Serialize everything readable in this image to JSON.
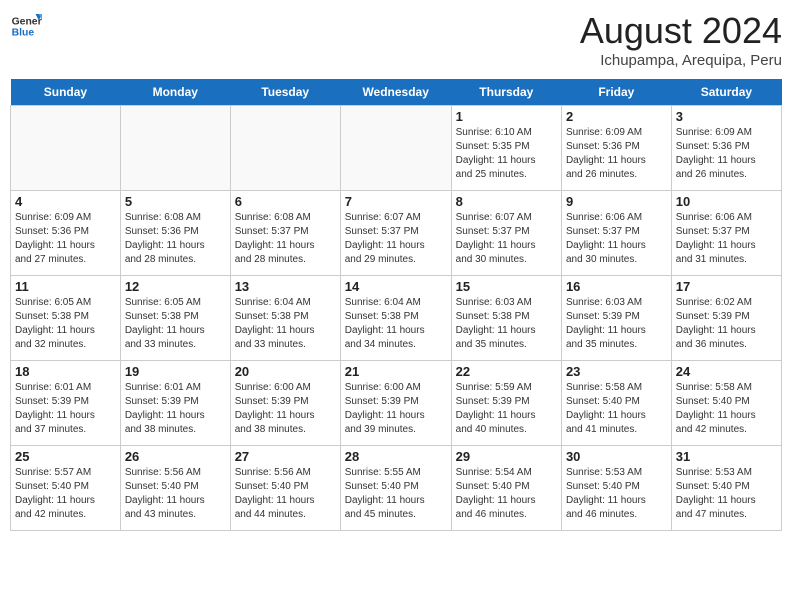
{
  "header": {
    "logo_line1": "General",
    "logo_line2": "Blue",
    "main_title": "August 2024",
    "subtitle": "Ichupampa, Arequipa, Peru"
  },
  "days_of_week": [
    "Sunday",
    "Monday",
    "Tuesday",
    "Wednesday",
    "Thursday",
    "Friday",
    "Saturday"
  ],
  "weeks": [
    [
      {
        "day": "",
        "info": ""
      },
      {
        "day": "",
        "info": ""
      },
      {
        "day": "",
        "info": ""
      },
      {
        "day": "",
        "info": ""
      },
      {
        "day": "1",
        "info": "Sunrise: 6:10 AM\nSunset: 5:35 PM\nDaylight: 11 hours\nand 25 minutes."
      },
      {
        "day": "2",
        "info": "Sunrise: 6:09 AM\nSunset: 5:36 PM\nDaylight: 11 hours\nand 26 minutes."
      },
      {
        "day": "3",
        "info": "Sunrise: 6:09 AM\nSunset: 5:36 PM\nDaylight: 11 hours\nand 26 minutes."
      }
    ],
    [
      {
        "day": "4",
        "info": "Sunrise: 6:09 AM\nSunset: 5:36 PM\nDaylight: 11 hours\nand 27 minutes."
      },
      {
        "day": "5",
        "info": "Sunrise: 6:08 AM\nSunset: 5:36 PM\nDaylight: 11 hours\nand 28 minutes."
      },
      {
        "day": "6",
        "info": "Sunrise: 6:08 AM\nSunset: 5:37 PM\nDaylight: 11 hours\nand 28 minutes."
      },
      {
        "day": "7",
        "info": "Sunrise: 6:07 AM\nSunset: 5:37 PM\nDaylight: 11 hours\nand 29 minutes."
      },
      {
        "day": "8",
        "info": "Sunrise: 6:07 AM\nSunset: 5:37 PM\nDaylight: 11 hours\nand 30 minutes."
      },
      {
        "day": "9",
        "info": "Sunrise: 6:06 AM\nSunset: 5:37 PM\nDaylight: 11 hours\nand 30 minutes."
      },
      {
        "day": "10",
        "info": "Sunrise: 6:06 AM\nSunset: 5:37 PM\nDaylight: 11 hours\nand 31 minutes."
      }
    ],
    [
      {
        "day": "11",
        "info": "Sunrise: 6:05 AM\nSunset: 5:38 PM\nDaylight: 11 hours\nand 32 minutes."
      },
      {
        "day": "12",
        "info": "Sunrise: 6:05 AM\nSunset: 5:38 PM\nDaylight: 11 hours\nand 33 minutes."
      },
      {
        "day": "13",
        "info": "Sunrise: 6:04 AM\nSunset: 5:38 PM\nDaylight: 11 hours\nand 33 minutes."
      },
      {
        "day": "14",
        "info": "Sunrise: 6:04 AM\nSunset: 5:38 PM\nDaylight: 11 hours\nand 34 minutes."
      },
      {
        "day": "15",
        "info": "Sunrise: 6:03 AM\nSunset: 5:38 PM\nDaylight: 11 hours\nand 35 minutes."
      },
      {
        "day": "16",
        "info": "Sunrise: 6:03 AM\nSunset: 5:39 PM\nDaylight: 11 hours\nand 35 minutes."
      },
      {
        "day": "17",
        "info": "Sunrise: 6:02 AM\nSunset: 5:39 PM\nDaylight: 11 hours\nand 36 minutes."
      }
    ],
    [
      {
        "day": "18",
        "info": "Sunrise: 6:01 AM\nSunset: 5:39 PM\nDaylight: 11 hours\nand 37 minutes."
      },
      {
        "day": "19",
        "info": "Sunrise: 6:01 AM\nSunset: 5:39 PM\nDaylight: 11 hours\nand 38 minutes."
      },
      {
        "day": "20",
        "info": "Sunrise: 6:00 AM\nSunset: 5:39 PM\nDaylight: 11 hours\nand 38 minutes."
      },
      {
        "day": "21",
        "info": "Sunrise: 6:00 AM\nSunset: 5:39 PM\nDaylight: 11 hours\nand 39 minutes."
      },
      {
        "day": "22",
        "info": "Sunrise: 5:59 AM\nSunset: 5:39 PM\nDaylight: 11 hours\nand 40 minutes."
      },
      {
        "day": "23",
        "info": "Sunrise: 5:58 AM\nSunset: 5:40 PM\nDaylight: 11 hours\nand 41 minutes."
      },
      {
        "day": "24",
        "info": "Sunrise: 5:58 AM\nSunset: 5:40 PM\nDaylight: 11 hours\nand 42 minutes."
      }
    ],
    [
      {
        "day": "25",
        "info": "Sunrise: 5:57 AM\nSunset: 5:40 PM\nDaylight: 11 hours\nand 42 minutes."
      },
      {
        "day": "26",
        "info": "Sunrise: 5:56 AM\nSunset: 5:40 PM\nDaylight: 11 hours\nand 43 minutes."
      },
      {
        "day": "27",
        "info": "Sunrise: 5:56 AM\nSunset: 5:40 PM\nDaylight: 11 hours\nand 44 minutes."
      },
      {
        "day": "28",
        "info": "Sunrise: 5:55 AM\nSunset: 5:40 PM\nDaylight: 11 hours\nand 45 minutes."
      },
      {
        "day": "29",
        "info": "Sunrise: 5:54 AM\nSunset: 5:40 PM\nDaylight: 11 hours\nand 46 minutes."
      },
      {
        "day": "30",
        "info": "Sunrise: 5:53 AM\nSunset: 5:40 PM\nDaylight: 11 hours\nand 46 minutes."
      },
      {
        "day": "31",
        "info": "Sunrise: 5:53 AM\nSunset: 5:40 PM\nDaylight: 11 hours\nand 47 minutes."
      }
    ]
  ]
}
